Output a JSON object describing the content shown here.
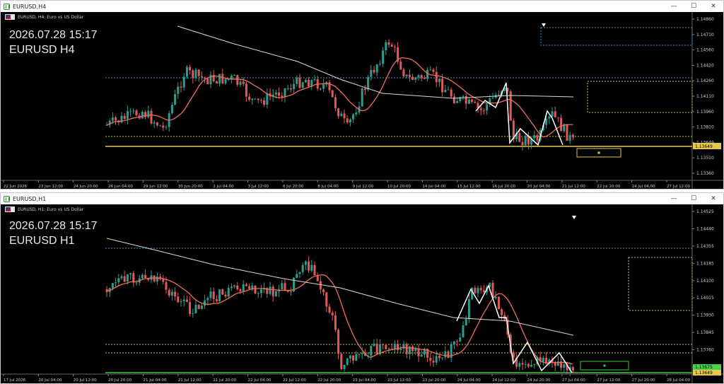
{
  "colors": {
    "bull": "#2a9d8f",
    "bear": "#e05a5a",
    "ma_fast": "#f06d5b",
    "ma_slow": "#d8d8d8",
    "zigzag": "#ffffff",
    "level_cyan": "#3a9ac9",
    "level_yellow": "#c8c83c",
    "level_green": "#3fc63f",
    "price_label": "#e6c84a",
    "price_label_green": "#4bd04b",
    "axis_text": "#cfcfcf"
  },
  "windows": [
    {
      "title": "EURUSD,H4",
      "symbol_desc": "EURUSD, H4:  Euro vs US Dollar",
      "overlay_line1": "2026.07.28 15:17",
      "overlay_line2": "EURUSD H4",
      "current_price": "1.13649",
      "price_ticks": [
        "1.14860",
        "1.14710",
        "1.14560",
        "1.14420",
        "1.14260",
        "1.14110",
        "1.13960",
        "1.13810",
        "1.13649",
        "1.13510",
        "1.13360"
      ],
      "time_ticks": [
        "22 Jun 2026",
        "23 Jun 12:00",
        "24 Jun 20:00",
        "26 Jun 04:00",
        "29 Jun 12:00",
        "30 Jun 20:00",
        "2 Jul 04:00",
        "3 Jul 12:00",
        "6 Jul 20:00",
        "8 Jul 04:00",
        "9 Jul 12:00",
        "10 Jul 20:00",
        "14 Jul 04:00",
        "15 Jul 12:00",
        "16 Jul 20:00",
        "20 Jul 04:00",
        "21 Jul 12:00",
        "22 Jul 20:00",
        "24 Jul 04:00",
        "27 Jul 12:00"
      ],
      "seed": 7
    },
    {
      "title": "EURUSD,H1",
      "symbol_desc": "EURUSD, H1:  Euro vs US Dollar",
      "overlay_line1": "2026.07.28 15:17",
      "overlay_line2": "EURUSD H1",
      "current_price": "1.13649",
      "current_price_green": "1.13675",
      "price_ticks": [
        "1.14525",
        "1.14440",
        "1.14355",
        "1.14185",
        "1.14100",
        "1.14015",
        "1.13930",
        "1.13845",
        "1.13760",
        "1.13675"
      ],
      "time_ticks": [
        "17 Jul 2026",
        "20 Jul 04:00",
        "20 Jul 12:00",
        "20 Jul 20:00",
        "21 Jul 04:00",
        "21 Jul 12:00",
        "21 Jul 20:00",
        "22 Jul 04:00",
        "22 Jul 12:00",
        "22 Jul 20:00",
        "23 Jul 04:00",
        "23 Jul 12:00",
        "23 Jul 20:00",
        "24 Jul 04:00",
        "24 Jul 12:00",
        "24 Jul 20:00",
        "27 Jul 04:00",
        "27 Jul 12:00",
        "27 Jul 20:00",
        "28 Jul 04:00"
      ],
      "seed": 13
    }
  ]
}
